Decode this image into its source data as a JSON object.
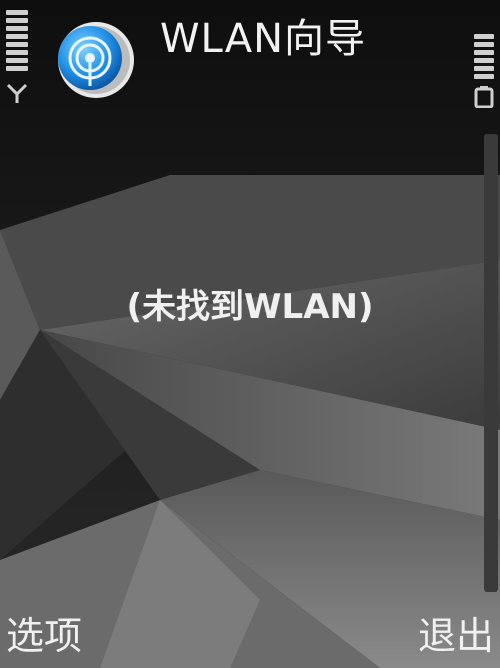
{
  "header": {
    "title": "WLAN向导"
  },
  "status": {
    "signal_bars": 6,
    "battery_bars": 5
  },
  "main": {
    "message": "(未找到WLAN)"
  },
  "softkeys": {
    "left_label": "选项",
    "right_label": "退出"
  },
  "colors": {
    "background": "#1c1c1c",
    "text": "#f0f0f0",
    "icon_blue": "#1f8ee6"
  },
  "icons": {
    "app": "wlan-wizard-icon",
    "signal": "signal-strength-icon",
    "antenna": "antenna-icon",
    "battery": "battery-icon"
  }
}
